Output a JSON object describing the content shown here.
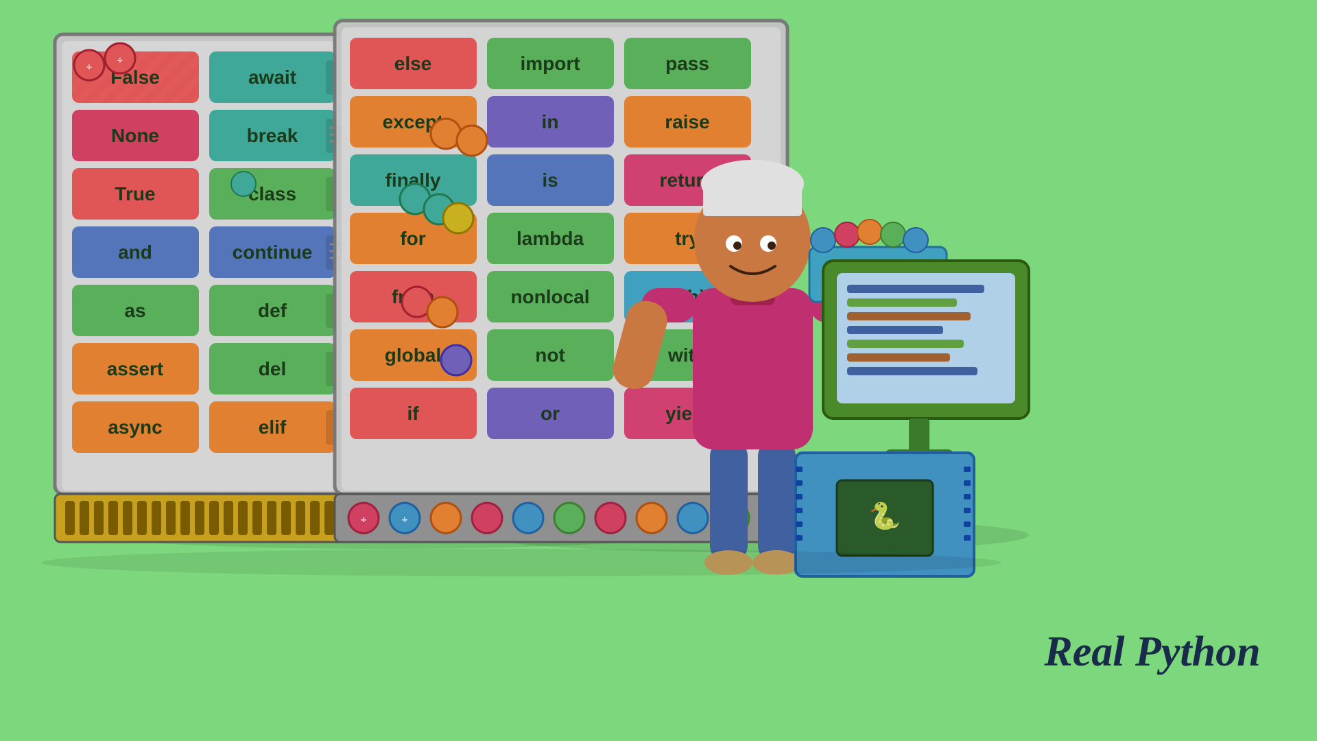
{
  "background_color": "#7dd87d",
  "brand": {
    "name": "Real Python",
    "line1": "Real",
    "line2": "Python"
  },
  "left_cabinet": {
    "keywords": [
      {
        "text": "False",
        "color": "#e05555",
        "col": 0,
        "row": 0
      },
      {
        "text": "await",
        "color": "#40a898",
        "col": 1,
        "row": 0
      },
      {
        "text": "None",
        "color": "#d04060",
        "col": 0,
        "row": 1
      },
      {
        "text": "break",
        "color": "#40a898",
        "col": 1,
        "row": 1
      },
      {
        "text": "True",
        "color": "#e05555",
        "col": 0,
        "row": 2
      },
      {
        "text": "class",
        "color": "#5ab05a",
        "col": 1,
        "row": 2
      },
      {
        "text": "and",
        "color": "#5575bb",
        "col": 0,
        "row": 3
      },
      {
        "text": "continue",
        "color": "#5575bb",
        "col": 1,
        "row": 3
      },
      {
        "text": "as",
        "color": "#5ab05a",
        "col": 0,
        "row": 4
      },
      {
        "text": "def",
        "color": "#5ab05a",
        "col": 1,
        "row": 4
      },
      {
        "text": "assert",
        "color": "#e08030",
        "col": 0,
        "row": 5
      },
      {
        "text": "del",
        "color": "#5ab05a",
        "col": 1,
        "row": 5
      },
      {
        "text": "async",
        "color": "#e08030",
        "col": 0,
        "row": 6
      },
      {
        "text": "elif",
        "color": "#e08030",
        "col": 1,
        "row": 6
      }
    ]
  },
  "right_cabinet": {
    "keywords": [
      {
        "text": "else",
        "color": "#e05555",
        "col": 0,
        "row": 0
      },
      {
        "text": "import",
        "color": "#5ab05a",
        "col": 1,
        "row": 0
      },
      {
        "text": "pass",
        "color": "#5ab05a",
        "col": 2,
        "row": 0
      },
      {
        "text": "except",
        "color": "#e08030",
        "col": 0,
        "row": 1
      },
      {
        "text": "in",
        "color": "#7060b8",
        "col": 1,
        "row": 1
      },
      {
        "text": "raise",
        "color": "#e08030",
        "col": 2,
        "row": 1
      },
      {
        "text": "finally",
        "color": "#40a898",
        "col": 0,
        "row": 2
      },
      {
        "text": "is",
        "color": "#5575bb",
        "col": 1,
        "row": 2
      },
      {
        "text": "return",
        "color": "#d04070",
        "col": 2,
        "row": 2
      },
      {
        "text": "for",
        "color": "#e08030",
        "col": 0,
        "row": 3
      },
      {
        "text": "lambda",
        "color": "#5ab05a",
        "col": 1,
        "row": 3
      },
      {
        "text": "try",
        "color": "#e08030",
        "col": 2,
        "row": 3
      },
      {
        "text": "from",
        "color": "#e05555",
        "col": 0,
        "row": 4
      },
      {
        "text": "nonlocal",
        "color": "#5ab05a",
        "col": 1,
        "row": 4
      },
      {
        "text": "while",
        "color": "#40a0c0",
        "col": 2,
        "row": 4
      },
      {
        "text": "global",
        "color": "#e08030",
        "col": 0,
        "row": 5
      },
      {
        "text": "not",
        "color": "#5ab05a",
        "col": 1,
        "row": 5
      },
      {
        "text": "with",
        "color": "#5ab05a",
        "col": 2,
        "row": 5
      },
      {
        "text": "if",
        "color": "#e05555",
        "col": 0,
        "row": 6
      },
      {
        "text": "or",
        "color": "#7060b8",
        "col": 1,
        "row": 6
      },
      {
        "text": "yield",
        "color": "#d04070",
        "col": 2,
        "row": 6
      }
    ]
  }
}
